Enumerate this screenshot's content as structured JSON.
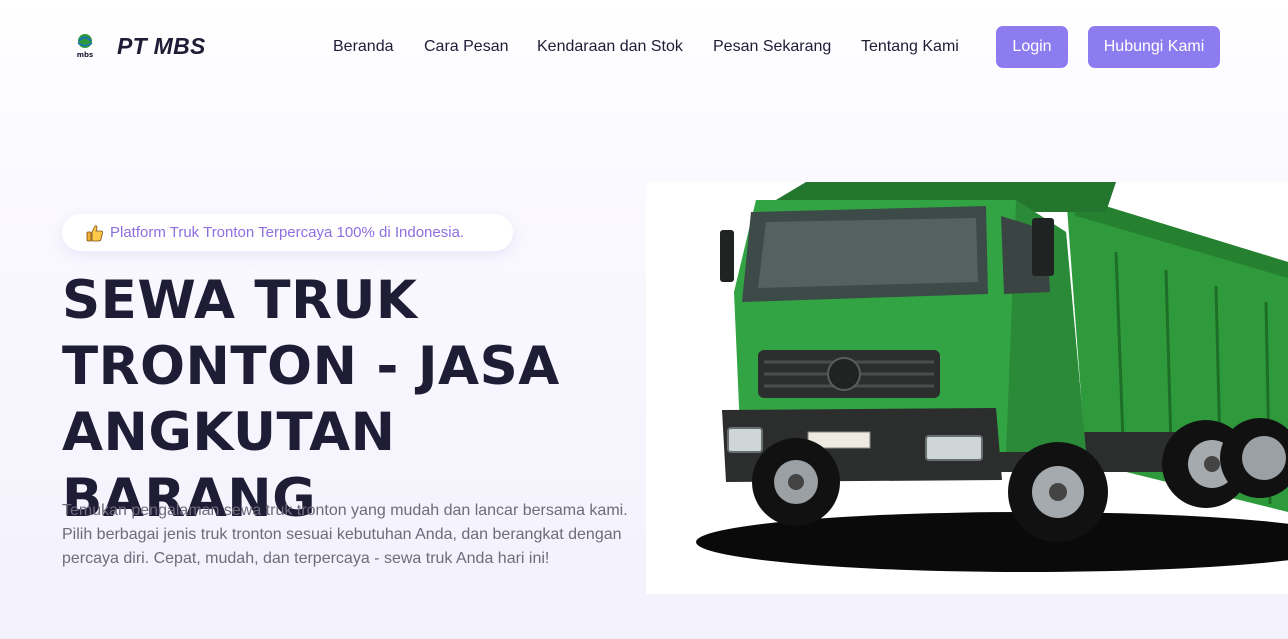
{
  "brand": {
    "name": "PT MBS",
    "logo_icon": "mbs-logo-icon",
    "logo_text": "mbs"
  },
  "nav": {
    "items": [
      {
        "label": "Beranda"
      },
      {
        "label": "Cara Pesan"
      },
      {
        "label": "Kendaraan dan Stok"
      },
      {
        "label": "Pesan Sekarang"
      },
      {
        "label": "Tentang Kami"
      }
    ],
    "login_label": "Login",
    "contact_label": "Hubungi Kami"
  },
  "hero": {
    "badge_icon": "thumbs-up-icon",
    "badge_text": "Platform Truk Tronton Terpercaya 100% di Indonesia.",
    "title_lines": [
      "SEWA TRUK",
      "TRONTON - JASA",
      "ANGKUTAN BARANG"
    ],
    "description": "Temukan pengalaman sewa truk tronton yang mudah dan lancar bersama kami. Pilih berbagai jenis truk tronton sesuai kebutuhan Anda, dan berangkat dengan percaya diri. Cepat, mudah, dan terpercaya - sewa truk Anda hari ini!",
    "image": "green-dump-truck-image"
  },
  "colors": {
    "accent": "#8d7cf0",
    "badge_text": "#8d6fe0",
    "heading": "#1f1d36",
    "body_text": "#6e6b7b",
    "truck_green": "#2f9a3c"
  }
}
